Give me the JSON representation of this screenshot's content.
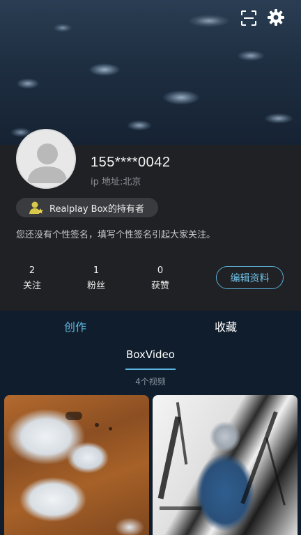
{
  "header": {
    "icons": [
      "scan-icon",
      "gear-icon"
    ]
  },
  "profile": {
    "username": "155****0042",
    "ip": "ip 地址:北京",
    "badge": "Realplay Box的持有者",
    "signature": "您还没有个性签名，填写个性签名引起大家关注。"
  },
  "stats": [
    {
      "value": "2",
      "label": "关注"
    },
    {
      "value": "1",
      "label": "粉丝"
    },
    {
      "value": "0",
      "label": "获赞"
    }
  ],
  "edit_label": "编辑资料",
  "tabs": [
    {
      "label": "创作",
      "active": true
    },
    {
      "label": "收藏",
      "active": false
    }
  ],
  "subtab": {
    "label": "BoxVideo",
    "count": "4个视频"
  },
  "colors": {
    "accent": "#5db6e0",
    "panel": "#202124",
    "background": "#0f1d2c"
  }
}
